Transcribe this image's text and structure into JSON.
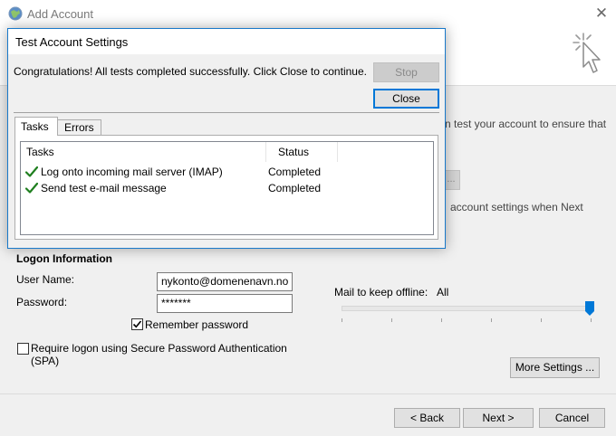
{
  "window": {
    "title": "Add Account",
    "close_glyph": "✕",
    "behind_text": {
      "line1": "n test your account to ensure that",
      "line2": "account settings when Next",
      "partial_button": "..."
    }
  },
  "logon": {
    "section_title": "Logon Information",
    "username_label": "User Name:",
    "username_value": "nykonto@domenenavn.no",
    "password_label": "Password:",
    "password_value": "*******",
    "remember_label": "Remember password",
    "remember_checked": true,
    "spa_label_line1": "Require logon using Secure Password Authentication",
    "spa_label_line2": "(SPA)",
    "spa_checked": false
  },
  "offline": {
    "label": "Mail to keep offline:",
    "value": "All",
    "slider_level": 1.0
  },
  "buttons": {
    "more_settings": "More Settings ...",
    "back": "< Back",
    "next": "Next >",
    "cancel": "Cancel"
  },
  "dialog": {
    "title": "Test Account Settings",
    "message": "Congratulations! All tests completed successfully. Click Close to continue.",
    "stop_label": "Stop",
    "close_label": "Close",
    "tabs": [
      {
        "label": "Tasks",
        "active": true
      },
      {
        "label": "Errors",
        "active": false
      }
    ],
    "columns": [
      "Tasks",
      "Status"
    ],
    "rows": [
      {
        "task": "Log onto incoming mail server (IMAP)",
        "status": "Completed"
      },
      {
        "task": "Send test e-mail message",
        "status": "Completed"
      }
    ]
  },
  "icons": {
    "window": "globe-icon",
    "header": "cursor-sparkle-icon",
    "row_status": "green-check-icon"
  },
  "colors": {
    "accent": "#0078d7",
    "check_green": "#1f7f1f"
  }
}
